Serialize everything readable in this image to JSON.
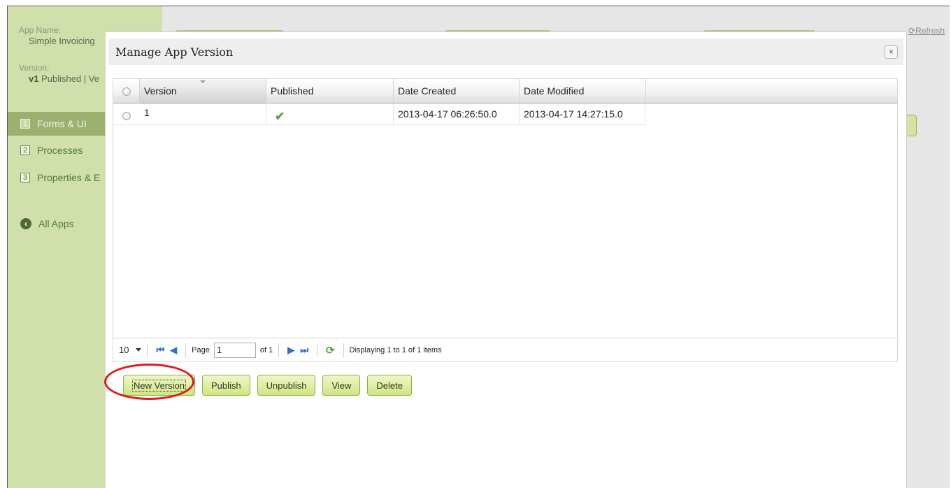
{
  "background": {
    "app_name_label": "App Name:",
    "app_name": "Simple Invoicing",
    "version_label": "Version:",
    "version_number": "v1",
    "version_status": " Published | Ve",
    "sidebar_items": [
      {
        "num": "1",
        "label": "Forms & UI",
        "active": true
      },
      {
        "num": "2",
        "label": "Processes",
        "active": false
      },
      {
        "num": "3",
        "label": "Properties & E",
        "active": false
      }
    ],
    "all_apps": "All Apps",
    "refresh": "Refresh"
  },
  "dialog": {
    "title": "Manage App Version",
    "close": "×",
    "grid": {
      "columns": [
        "Version",
        "Published",
        "Date Created",
        "Date Modified"
      ],
      "rows": [
        {
          "version": "1",
          "published": "✔",
          "date_created": "2013-04-17 06:26:50.0",
          "date_modified": "2013-04-17 14:27:15.0"
        }
      ]
    },
    "pager": {
      "page_size": "10",
      "first": "⏮",
      "prev": "◀",
      "page_label": "Page",
      "page": "1",
      "of_label": "of 1",
      "next": "▶",
      "last": "⏭",
      "refresh": "⟳",
      "status": "Displaying 1 to 1 of 1 items"
    },
    "buttons": {
      "new_version": "New Version",
      "publish": "Publish",
      "unpublish": "Unpublish",
      "view": "View",
      "delete": "Delete"
    }
  },
  "colors": {
    "sidebar_bg": "#d1dfab",
    "button_green": "#cfe584",
    "annotation_red": "#e01b1b"
  }
}
